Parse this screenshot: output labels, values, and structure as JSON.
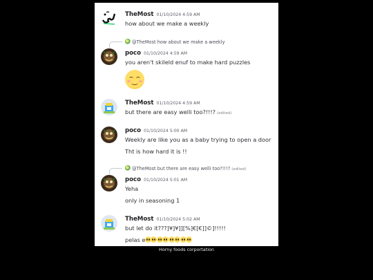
{
  "caption": "Horny foods corportation",
  "colors": {
    "background": "#000000",
    "panel": "#ffffff",
    "text": "#2e3035",
    "timestamp": "#5c5e66"
  },
  "messages": [
    {
      "author": "TheMost",
      "timestamp": "01/10/2024 4:59 AM",
      "avatar": "arabic-calligraphy-avatar",
      "lines": [
        "how about we make a weekly"
      ]
    },
    {
      "author": "poco",
      "timestamp": "01/10/2024 4:59 AM",
      "avatar": "poco-avatar",
      "reply": {
        "author": "@TheMost",
        "text": "how about we make a weekly"
      },
      "lines": [
        "you aren't skileld enuf to make hard puzzles"
      ],
      "emoji": "smiling-blush-emoji"
    },
    {
      "author": "TheMost",
      "timestamp": "01/10/2024 4:59 AM",
      "avatar": "themost-sprite-avatar",
      "lines": [
        "but there are easy welli too?!!!?"
      ],
      "edited": "(edited)"
    },
    {
      "author": "poco",
      "timestamp": "01/10/2024 5:00 AM",
      "avatar": "poco-avatar",
      "lines": [
        "Weekly are like you as a baby trying to open a door",
        "Tht is how hard it is !!"
      ]
    },
    {
      "author": "poco",
      "timestamp": "01/10/2024 5:01 AM",
      "avatar": "poco-avatar",
      "reply": {
        "author": "@TheMost",
        "text": "but there are easy welli too?!!!?",
        "edited": "(edited)"
      },
      "lines": [
        "Yeha",
        "only in seasoning 1"
      ]
    },
    {
      "author": "TheMost",
      "timestamp": "01/10/2024 5:02 AM",
      "avatar": "themost-sprite-avatar",
      "lines": [
        "but let do it???]¥]¥]][%]€[€]]©]!!!!!",
        "pelas e"
      ],
      "pleading_emoji_count": 8
    }
  ]
}
